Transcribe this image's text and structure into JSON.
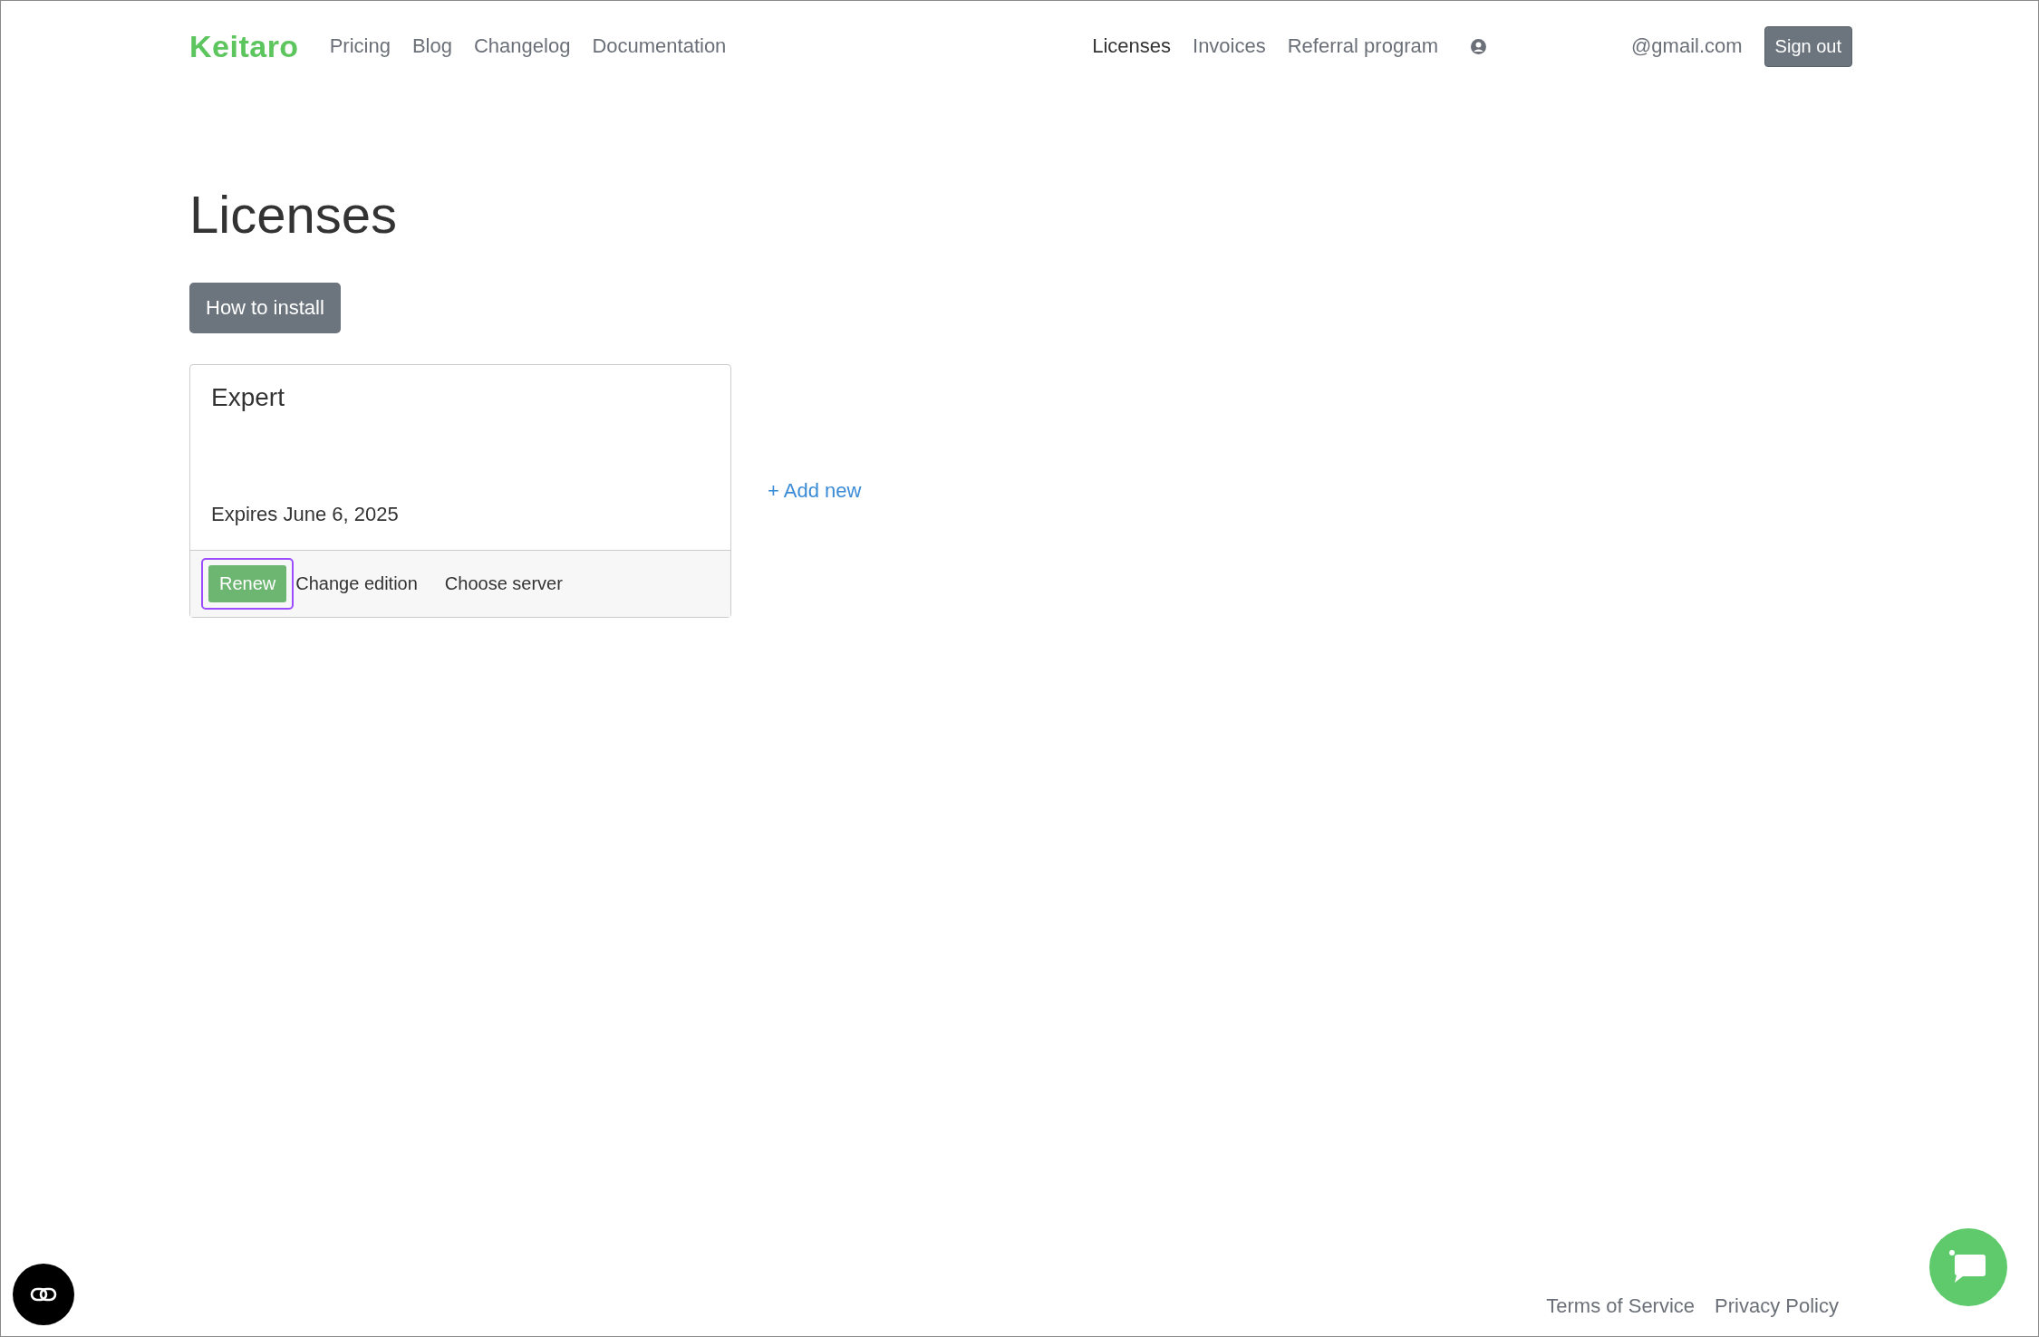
{
  "nav": {
    "logo": "Keitaro",
    "left_links": [
      {
        "label": "Pricing",
        "selected": false
      },
      {
        "label": "Blog",
        "selected": false
      },
      {
        "label": "Changelog",
        "selected": false
      },
      {
        "label": "Documentation",
        "selected": false
      }
    ],
    "right_links": [
      {
        "label": "Licenses",
        "selected": true
      },
      {
        "label": "Invoices",
        "selected": false
      },
      {
        "label": "Referral program",
        "selected": false
      }
    ],
    "email": "@gmail.com",
    "sign_out": "Sign out"
  },
  "page": {
    "title": "Licenses",
    "install_button": "How to install"
  },
  "licenses": [
    {
      "edition": "Expert",
      "expires": "Expires June 6, 2025",
      "actions": [
        {
          "label": "Renew",
          "kind": "primary",
          "focused": true
        },
        {
          "label": "Change edition",
          "kind": "link",
          "focused": false
        },
        {
          "label": "Choose server",
          "kind": "link",
          "focused": false
        }
      ]
    }
  ],
  "add_new": "+ Add new",
  "footer": {
    "links": [
      "Terms of Service",
      "Privacy Policy"
    ]
  }
}
